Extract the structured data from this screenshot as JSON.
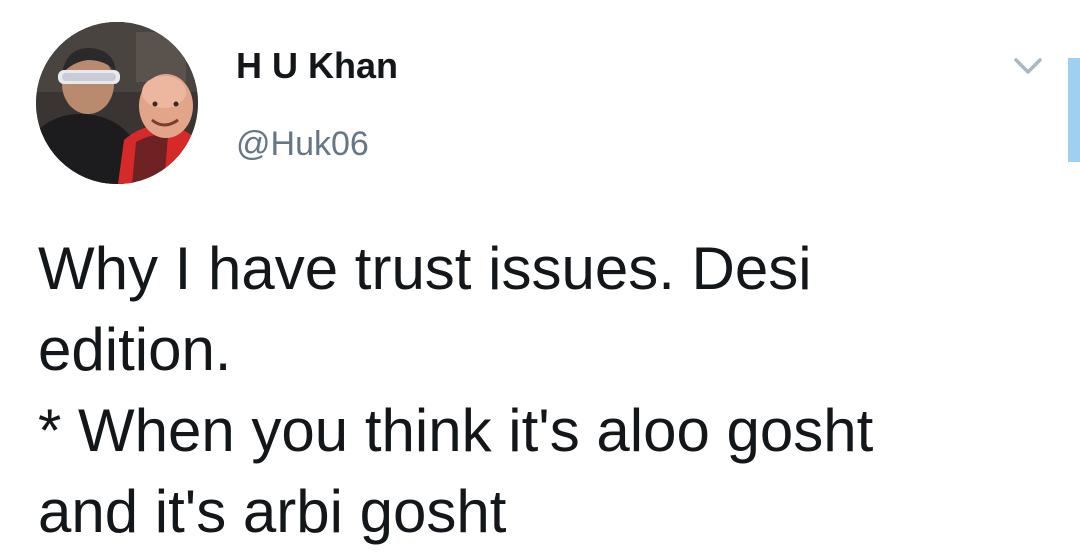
{
  "tweet": {
    "author": {
      "display_name": "H U Khan",
      "handle": "@Huk06"
    },
    "text": "Why I have trust issues. Desi\nedition.\n* When you think it's aloo gosht\nand it's arbi gosht"
  },
  "icons": {
    "menu_caret": "chevron-down-icon",
    "avatar": "profile-photo"
  },
  "colors": {
    "text_primary": "#14171a",
    "text_secondary": "#657786",
    "caret": "#aab8c2",
    "scroll_indicator": "#9fd0f2",
    "background": "#ffffff"
  }
}
